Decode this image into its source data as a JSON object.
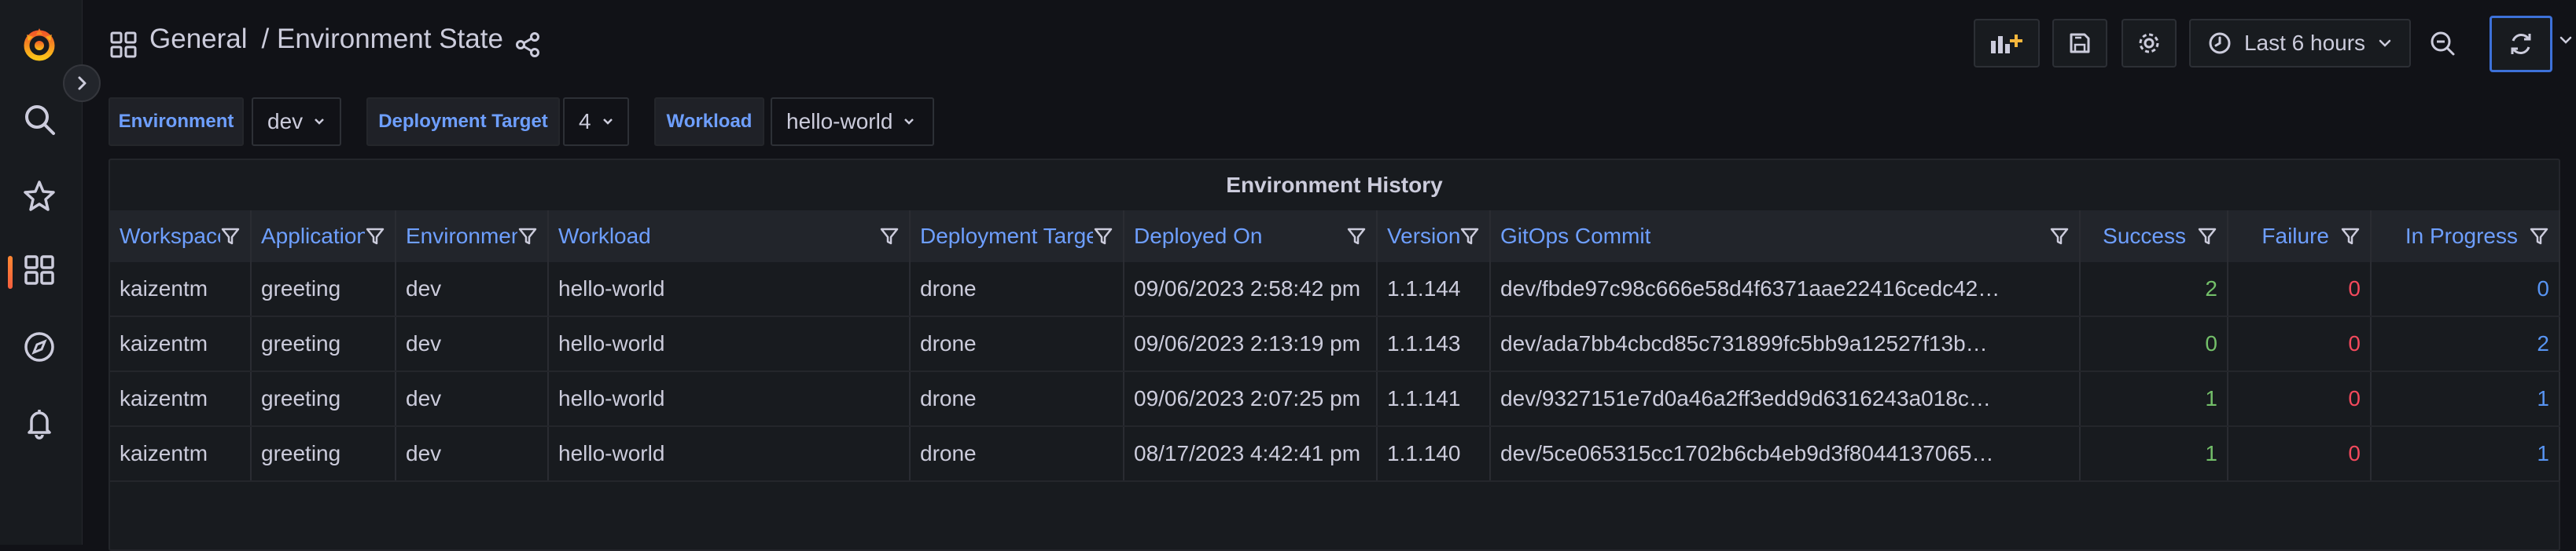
{
  "breadcrumb": {
    "folder": "General",
    "separator": "/",
    "dashboard": "Environment State"
  },
  "toolbar": {
    "time_range": "Last 6 hours"
  },
  "variables": [
    {
      "label": "Environment",
      "value": "dev"
    },
    {
      "label": "Deployment Target",
      "value": "4"
    },
    {
      "label": "Workload",
      "value": "hello-world"
    }
  ],
  "panel": {
    "title": "Environment History",
    "columns": [
      "Workspace",
      "Application",
      "Environment",
      "Workload",
      "Deployment Target",
      "Deployed On",
      "Version",
      "GitOps Commit",
      "Success",
      "Failure",
      "In Progress"
    ],
    "rows": [
      [
        "kaizentm",
        "greeting",
        "dev",
        "hello-world",
        "drone",
        "09/06/2023 2:58:42 pm",
        "1.1.144",
        "dev/fbde97c98c666e58d4f6371aae22416cedc42…",
        "2",
        "0",
        "0"
      ],
      [
        "kaizentm",
        "greeting",
        "dev",
        "hello-world",
        "drone",
        "09/06/2023 2:13:19 pm",
        "1.1.143",
        "dev/ada7bb4cbcd85c731899fc5bb9a12527f13b…",
        "0",
        "0",
        "2"
      ],
      [
        "kaizentm",
        "greeting",
        "dev",
        "hello-world",
        "drone",
        "09/06/2023 2:07:25 pm",
        "1.1.141",
        "dev/9327151e7d0a46a2ff3edd9d6316243a018c…",
        "1",
        "0",
        "1"
      ],
      [
        "kaizentm",
        "greeting",
        "dev",
        "hello-world",
        "drone",
        "08/17/2023 4:42:41 pm",
        "1.1.140",
        "dev/5ce065315cc1702b6cb4eb9d3f8044137065…",
        "1",
        "0",
        "1"
      ]
    ]
  },
  "colors": {
    "success": "#73bf69",
    "failure": "#f2495c",
    "in_progress": "#5794f2",
    "accent": "#6e9fff"
  }
}
